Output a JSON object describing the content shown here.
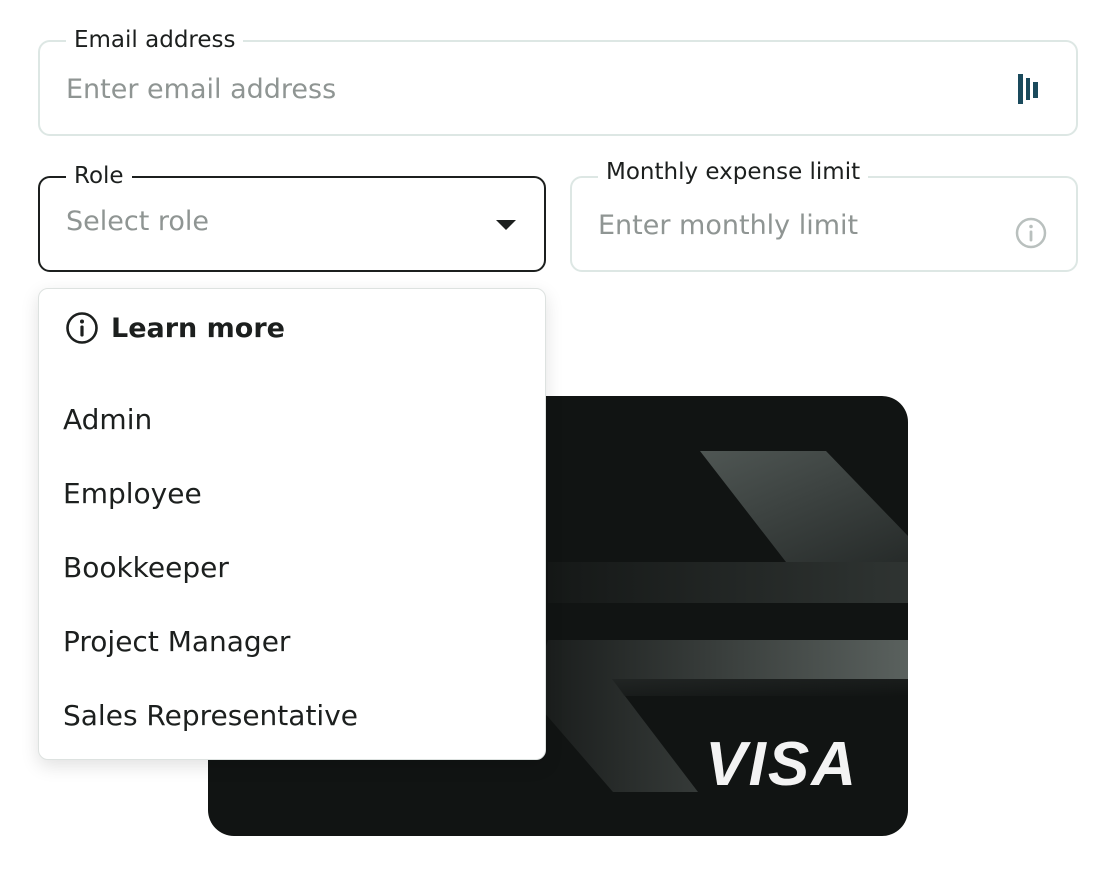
{
  "email": {
    "label": "Email address",
    "placeholder": "Enter email address",
    "value": ""
  },
  "role": {
    "label": "Role",
    "placeholder": "Select role",
    "dropdown": {
      "learn_more": "Learn more",
      "options": [
        "Admin",
        "Employee",
        "Bookkeeper",
        "Project Manager",
        "Sales Representative"
      ]
    }
  },
  "limit": {
    "label": "Monthly expense limit",
    "placeholder": "Enter monthly limit",
    "value": ""
  },
  "card": {
    "brand": "VISA"
  },
  "icons": {
    "email_field_icon": "password-manager-icon",
    "limit_field_icon": "info-icon",
    "role_field_icon": "chevron-down-icon",
    "learn_more_icon": "info-icon"
  },
  "colors": {
    "accent": "#1a4a5c",
    "border": "#dde7e4",
    "card": "#111413",
    "text": "#1c1f1e",
    "placeholder": "#8f9593"
  }
}
